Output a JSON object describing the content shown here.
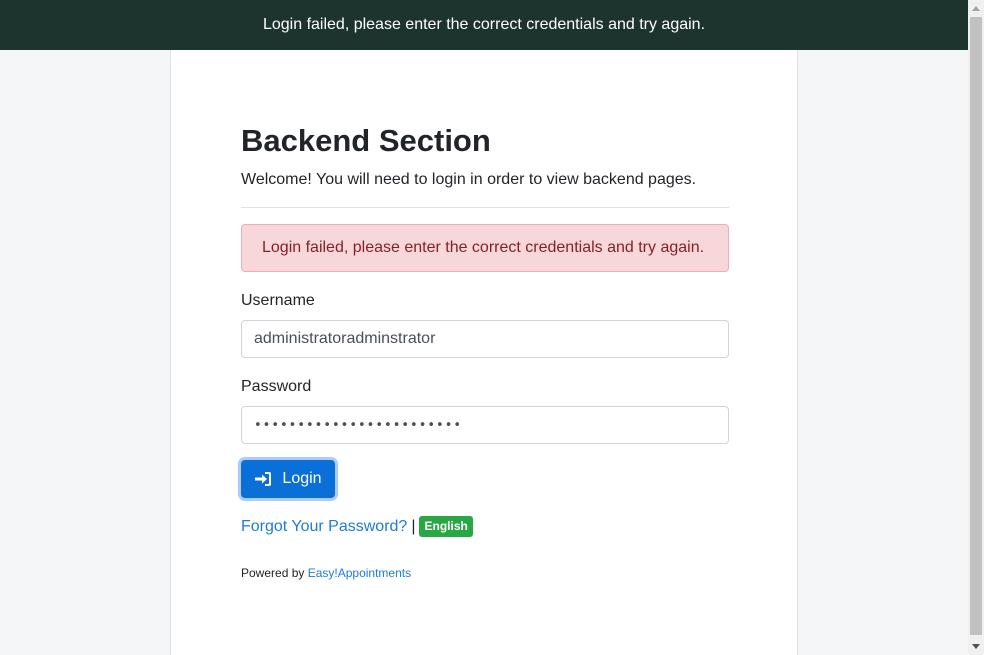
{
  "banner": {
    "message": "Login failed, please enter the correct credentials and try again."
  },
  "login": {
    "title": "Backend Section",
    "welcome": "Welcome! You will need to login in order to view backend pages.",
    "alert_message": "Login failed, please enter the correct credentials and try again.",
    "username_label": "Username",
    "username_value": "administratoradminstrator",
    "password_label": "Password",
    "password_value": "••••••••••••••••••••••••",
    "login_button_label": "Login",
    "forgot_password_link": "Forgot Your Password?",
    "separator": "|",
    "language_badge": "English",
    "powered_by_prefix": "Powered by",
    "powered_by_link": "Easy!Appointments"
  },
  "icons": {
    "login_icon": "sign-in-icon",
    "scroll_up": "scroll-up-arrow-icon",
    "scroll_down": "scroll-down-arrow-icon"
  },
  "colors": {
    "banner_bg": "#1c342d",
    "primary": "#0b6fd8",
    "alert_bg": "#f8d7da",
    "alert_text": "#842029",
    "badge_green": "#28a745",
    "link": "#1e7bd6"
  }
}
